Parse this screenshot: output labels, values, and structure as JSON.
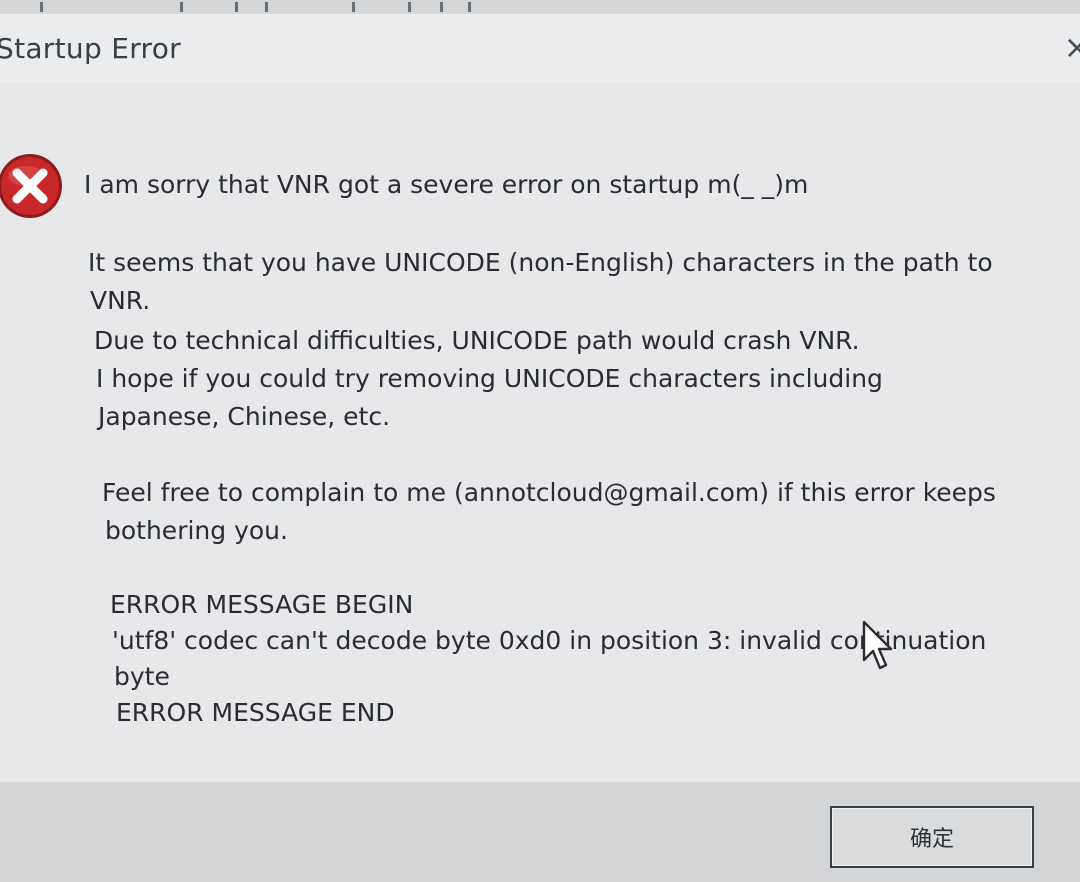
{
  "window": {
    "title": "Startup Error",
    "close_glyph": "×"
  },
  "message": {
    "line1": "I am sorry that VNR got a severe error on startup m(_ _)m",
    "line2": "It seems that you have UNICODE (non-English) characters in the path to",
    "line3": "VNR.",
    "line4": "Due to technical difficulties, UNICODE path would crash VNR.",
    "line5": "I hope if you could try removing UNICODE characters including",
    "line6": "Japanese, Chinese, etc.",
    "line7": "Feel free to complain to me (annotcloud@gmail.com) if this error keeps",
    "line8": "bothering you.",
    "line9": "ERROR MESSAGE BEGIN",
    "line10": "'utf8' codec can't decode byte 0xd0 in position 3: invalid continuation",
    "line11": "byte",
    "line12": "ERROR MESSAGE END"
  },
  "buttons": {
    "ok_label": "确定"
  },
  "icons": {
    "error": "error-icon",
    "close": "close-icon",
    "cursor": "mouse-cursor-icon"
  },
  "colors": {
    "error_red": "#c8282a",
    "dialog_bg": "#e6e8e9",
    "text": "#2a2c30"
  }
}
